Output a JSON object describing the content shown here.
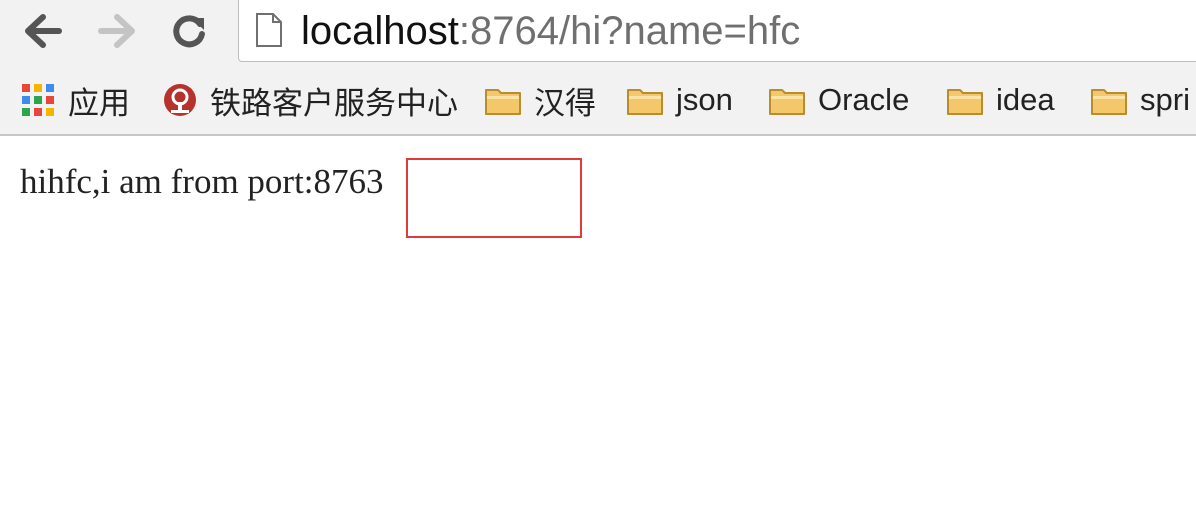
{
  "toolbar": {
    "back_icon": "arrow-left-icon",
    "forward_icon": "arrow-right-icon",
    "reload_icon": "reload-icon"
  },
  "address_bar": {
    "host": "localhost",
    "rest": ":8764/hi?name=hfc"
  },
  "bookmarks": [
    {
      "label": "应用",
      "icon": "apps-grid-icon"
    },
    {
      "label": "铁路客户服务中心",
      "icon": "railway-logo-icon"
    },
    {
      "label": "汉得",
      "icon": "folder-icon"
    },
    {
      "label": "json",
      "icon": "folder-icon"
    },
    {
      "label": "Oracle",
      "icon": "folder-icon"
    },
    {
      "label": "idea",
      "icon": "folder-icon"
    },
    {
      "label": "spri",
      "icon": "folder-icon"
    }
  ],
  "page": {
    "text": "hihfc,i am from port:8763"
  },
  "colors": {
    "highlight": "#e03b3b",
    "folder": "#f3c86a",
    "chrome_bg": "#f2f2f2"
  }
}
